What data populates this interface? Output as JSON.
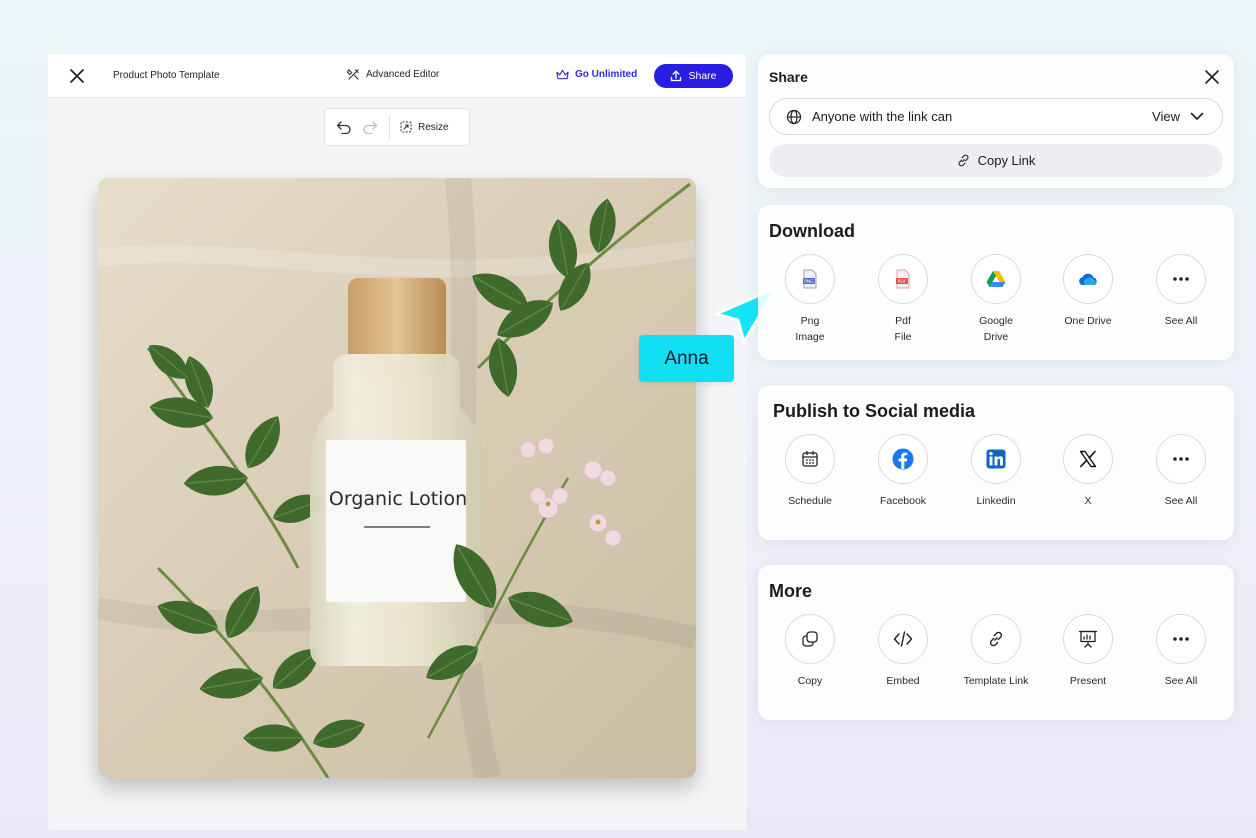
{
  "editor": {
    "doc_title": "Product Photo Template",
    "advanced_editor": "Advanced Editor",
    "go_unlimited": "Go Unlimited",
    "share_button": "Share",
    "resize": "Resize",
    "accent_color": "#2a1de3"
  },
  "canvas": {
    "product_label": "Organic Lotion"
  },
  "collaborator": {
    "name": "Anna",
    "color": "#12e0f2"
  },
  "share": {
    "title": "Share",
    "access_text": "Anyone with the link can",
    "permission": "View",
    "copy_link": "Copy Link"
  },
  "download": {
    "title": "Download",
    "items": [
      {
        "label": "Png\nImage",
        "icon": "png-file-icon"
      },
      {
        "label": "Pdf\nFile",
        "icon": "pdf-file-icon"
      },
      {
        "label": "Google\nDrive",
        "icon": "google-drive-icon"
      },
      {
        "label": "One Drive",
        "icon": "onedrive-icon"
      },
      {
        "label": "See All",
        "icon": "more-dots-icon"
      }
    ]
  },
  "social": {
    "title": "Publish to Social media",
    "items": [
      {
        "label": "Schedule",
        "icon": "calendar-icon"
      },
      {
        "label": "Facebook",
        "icon": "facebook-icon"
      },
      {
        "label": "Linkedin",
        "icon": "linkedin-icon"
      },
      {
        "label": "X",
        "icon": "x-icon"
      },
      {
        "label": "See All",
        "icon": "more-dots-icon"
      }
    ]
  },
  "more": {
    "title": "More",
    "items": [
      {
        "label": "Copy",
        "icon": "copy-icon"
      },
      {
        "label": "Embed",
        "icon": "code-icon"
      },
      {
        "label": "Template Link",
        "icon": "link-icon"
      },
      {
        "label": "Present",
        "icon": "presentation-icon"
      },
      {
        "label": "See All",
        "icon": "more-dots-icon"
      }
    ]
  }
}
